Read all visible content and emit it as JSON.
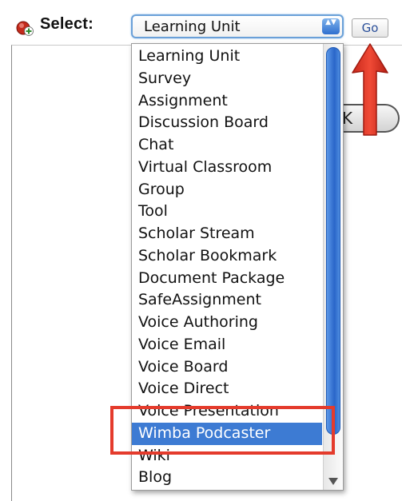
{
  "toolbar": {
    "select_label": "Select:",
    "select_value": "Learning Unit",
    "select_arrows": "▲▼",
    "go_label": "Go"
  },
  "background_button": {
    "partial_text": "K"
  },
  "dropdown": {
    "selected_index": 18,
    "options": [
      "Learning Unit",
      "Survey",
      "Assignment",
      "Discussion Board",
      "Chat",
      "Virtual Classroom",
      "Group",
      "Tool",
      "Scholar Stream",
      "Scholar Bookmark",
      "Document Package",
      "SafeAssignment",
      "Voice Authoring",
      "Voice Email",
      "Voice Board",
      "Voice Direct",
      "Voice Presentation",
      "Wimba Podcaster",
      "Wiki",
      "Blog"
    ]
  },
  "annotations": {
    "highlight_color": "#e43b2c",
    "arrow_color": "#e43b2c"
  },
  "colors": {
    "selection_blue": "#3d7bd3",
    "focus_ring": "#6aa0d8",
    "scroll_thumb": "#2a66c9"
  },
  "icons": {
    "add": "add-content-icon",
    "dropdown_arrows": "dropdown-arrows-icon",
    "scroll_down": "scroll-down-arrow-icon",
    "annotation_arrow": "annotation-up-arrow-icon"
  }
}
